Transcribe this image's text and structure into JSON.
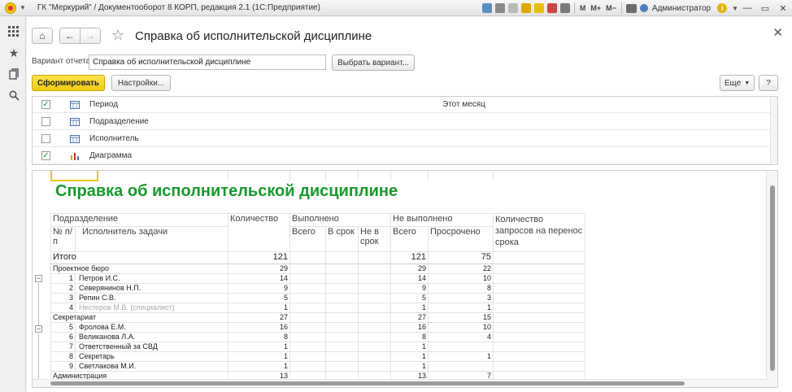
{
  "titlebar": {
    "title": "ГК \"Меркурий\" / Документооборот 8 КОРП, редакция 2.1  (1С:Предприятие)",
    "m_label": "M",
    "mplus_label": "M+",
    "mminus_label": "M−",
    "user": "Администратор",
    "info_icon": "i",
    "minimize": "—",
    "restore": "▭",
    "close": "✕"
  },
  "leftpanel": {
    "icons": [
      "apps-grid-icon",
      "star-icon",
      "history-icon",
      "search-icon"
    ]
  },
  "form": {
    "title": "Справка об исполнительской дисциплине",
    "home_icon": "⌂",
    "back_icon": "←",
    "forward_icon": "→",
    "star_icon": "☆",
    "close_icon": "✕"
  },
  "variant": {
    "label": "Вариант отчета:",
    "value": "Справка об исполнительской дисциплине",
    "select_button": "Выбрать вариант..."
  },
  "toolbar": {
    "generate": "Сформировать",
    "settings": "Настройки...",
    "more": "Еще",
    "help": "?"
  },
  "settings_rows": [
    {
      "checked": true,
      "mark": "✓",
      "label": "Период",
      "value": "Этот месяц"
    },
    {
      "checked": false,
      "mark": "",
      "label": "Подразделение",
      "value": ""
    },
    {
      "checked": false,
      "mark": "",
      "label": "Исполнитель",
      "value": ""
    },
    {
      "checked": true,
      "mark": "✓",
      "label": "Диаграмма",
      "value": ""
    }
  ],
  "report": {
    "title": "Справка об исполнительской дисциплине",
    "headers": {
      "department": "Подразделение",
      "count": "Количество",
      "done": "Выполнено",
      "not_done": "Не выполнено",
      "postpone": "Количество запросов на перенос срока",
      "num": "№ п/п",
      "executor": "Исполнитель задачи",
      "done_total": "Всего",
      "done_ontime": "В срок",
      "done_late": "Не в срок",
      "nd_total": "Всего",
      "nd_overdue": "Просрочено"
    },
    "total": {
      "label": "Итого",
      "count": "121",
      "nd_total": "121",
      "nd_overdue": "75"
    },
    "groups": [
      {
        "name": "Проектное бюро",
        "count": "29",
        "nd_total": "29",
        "nd_overdue": "22",
        "rows": [
          {
            "n": "1",
            "name": "Петров И.С.",
            "count": "14",
            "nd_total": "14",
            "nd_overdue": "10",
            "dim": false
          },
          {
            "n": "2",
            "name": "Северянинов Н.П.",
            "count": "9",
            "nd_total": "9",
            "nd_overdue": "8",
            "dim": false
          },
          {
            "n": "3",
            "name": "Репин С.В.",
            "count": "5",
            "nd_total": "5",
            "nd_overdue": "3",
            "dim": false
          },
          {
            "n": "4",
            "name": "Нестеров М.В. (специалист)",
            "count": "1",
            "nd_total": "1",
            "nd_overdue": "1",
            "dim": true
          }
        ]
      },
      {
        "name": "Секретариат",
        "count": "27",
        "nd_total": "27",
        "nd_overdue": "15",
        "rows": [
          {
            "n": "5",
            "name": "Фролова Е.М.",
            "count": "16",
            "nd_total": "16",
            "nd_overdue": "10",
            "dim": false
          },
          {
            "n": "6",
            "name": "Великанова Л.А.",
            "count": "8",
            "nd_total": "8",
            "nd_overdue": "4",
            "dim": false
          },
          {
            "n": "7",
            "name": "Ответственный за СВД",
            "count": "1",
            "nd_total": "1",
            "nd_overdue": "",
            "dim": false
          },
          {
            "n": "8",
            "name": "Секретарь",
            "count": "1",
            "nd_total": "1",
            "nd_overdue": "1",
            "dim": false
          },
          {
            "n": "9",
            "name": "Светлакова М.И.",
            "count": "1",
            "nd_total": "1",
            "nd_overdue": "",
            "dim": false
          }
        ]
      }
    ],
    "partial_row": {
      "name": "Администрация",
      "count": "13",
      "nd_total": "13",
      "nd_overdue": "7"
    }
  },
  "colors": {
    "accent_yellow": "#f2c90f",
    "title_green": "#169b2c"
  }
}
